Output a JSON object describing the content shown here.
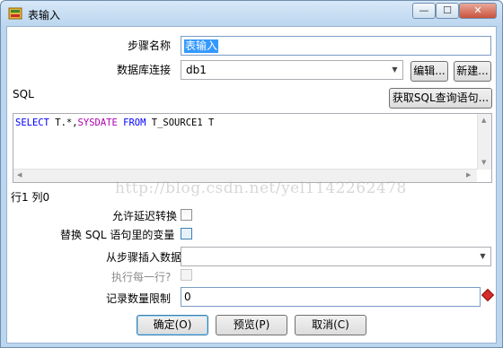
{
  "window": {
    "title": "表输入",
    "minimize_glyph": "—",
    "maximize_glyph": "☐",
    "close_glyph": "✕"
  },
  "form": {
    "step_name_label": "步骤名称",
    "step_name_value": "表输入",
    "db_connection_label": "数据库连接",
    "db_connection_value": "db1",
    "edit_button": "编辑...",
    "new_button": "新建...",
    "sql_label": "SQL",
    "get_sql_button": "获取SQL查询语句...",
    "sql": {
      "kw_select": "SELECT",
      "t1": " T.*,",
      "fn_sysdate": "SYSDATE",
      "t2": " ",
      "kw_from": "FROM",
      "t3": " T_SOURCE1 T"
    },
    "cursor_position": "行1 列0",
    "allow_lazy_conversion_label": "允许延迟转换",
    "replace_variables_label": "替换 SQL 语句里的变量",
    "insert_from_step_label": "从步骤插入数据",
    "insert_from_step_value": "",
    "execute_each_row_label": "执行每一行?",
    "limit_label": "记录数量限制",
    "limit_value": "0"
  },
  "buttons": {
    "ok": "确定(O)",
    "preview": "预览(P)",
    "cancel": "取消(C)"
  },
  "watermark": "http://blog.csdn.net/yel1142262478",
  "icons": {
    "app": "table-input-icon",
    "dropdown": "chevron-down-icon",
    "variable": "variable-diamond-icon"
  }
}
